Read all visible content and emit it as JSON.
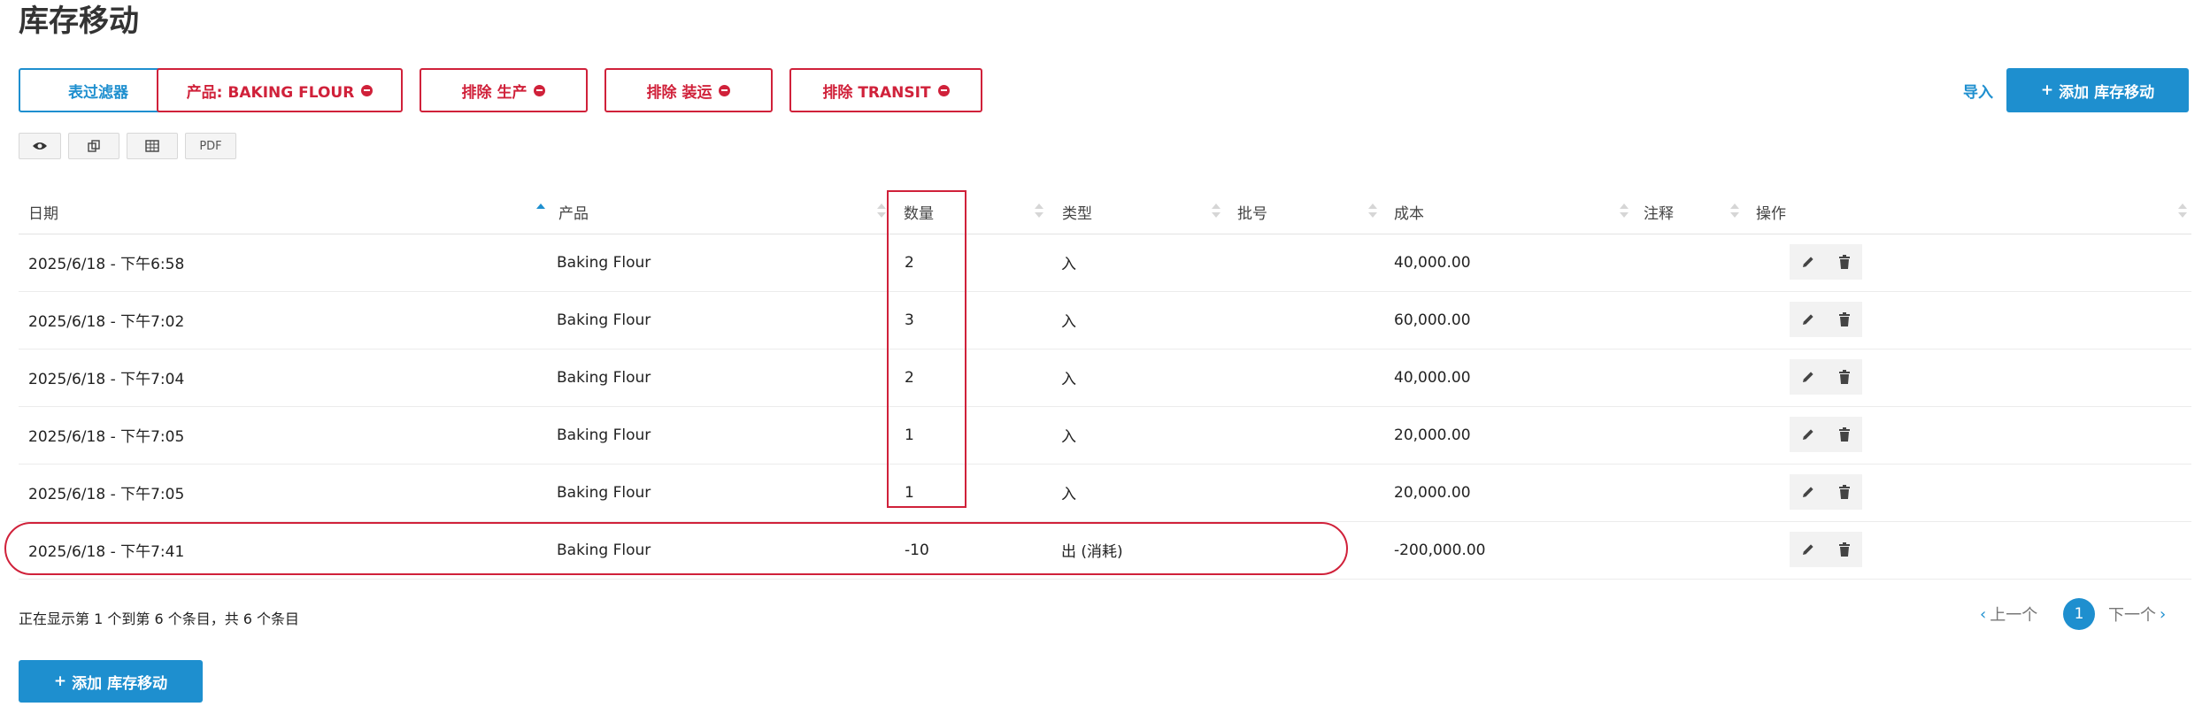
{
  "page": {
    "title": "库存移动"
  },
  "filters": {
    "table_filter": "表过滤器",
    "chips": [
      {
        "label": "产品: BAKING FLOUR"
      },
      {
        "label": "排除 生产"
      },
      {
        "label": "排除 装运"
      },
      {
        "label": "排除 TRANSIT"
      }
    ]
  },
  "header_actions": {
    "import": "导入",
    "add": "添加 库存移动"
  },
  "export": {
    "pdf": "PDF",
    "icons": [
      "eye-icon",
      "copy-icon",
      "table-icon"
    ]
  },
  "table": {
    "columns": [
      "日期",
      "产品",
      "数量",
      "类型",
      "批号",
      "成本",
      "注释",
      "操作"
    ],
    "sorted_column": "日期",
    "rows": [
      {
        "date": "2025/6/18 - 下午6:58",
        "product": "Baking Flour",
        "qty": "2",
        "type": "入",
        "lot": "",
        "cost": "40,000.00",
        "note": ""
      },
      {
        "date": "2025/6/18 - 下午7:02",
        "product": "Baking Flour",
        "qty": "3",
        "type": "入",
        "lot": "",
        "cost": "60,000.00",
        "note": ""
      },
      {
        "date": "2025/6/18 - 下午7:04",
        "product": "Baking Flour",
        "qty": "2",
        "type": "入",
        "lot": "",
        "cost": "40,000.00",
        "note": ""
      },
      {
        "date": "2025/6/18 - 下午7:05",
        "product": "Baking Flour",
        "qty": "1",
        "type": "入",
        "lot": "",
        "cost": "20,000.00",
        "note": ""
      },
      {
        "date": "2025/6/18 - 下午7:05",
        "product": "Baking Flour",
        "qty": "1",
        "type": "入",
        "lot": "",
        "cost": "20,000.00",
        "note": ""
      },
      {
        "date": "2025/6/18 - 下午7:41",
        "product": "Baking Flour",
        "qty": "-10",
        "type": "出 (消耗)",
        "lot": "",
        "cost": "-200,000.00",
        "note": ""
      }
    ]
  },
  "footer": {
    "info": "正在显示第 1 个到第 6 个条目，共 6 个条目",
    "prev": "上一个",
    "page": "1",
    "next": "下一个",
    "add": "添加 库存移动"
  },
  "colors": {
    "accent": "#1e8fcf",
    "danger": "#d0213a"
  }
}
